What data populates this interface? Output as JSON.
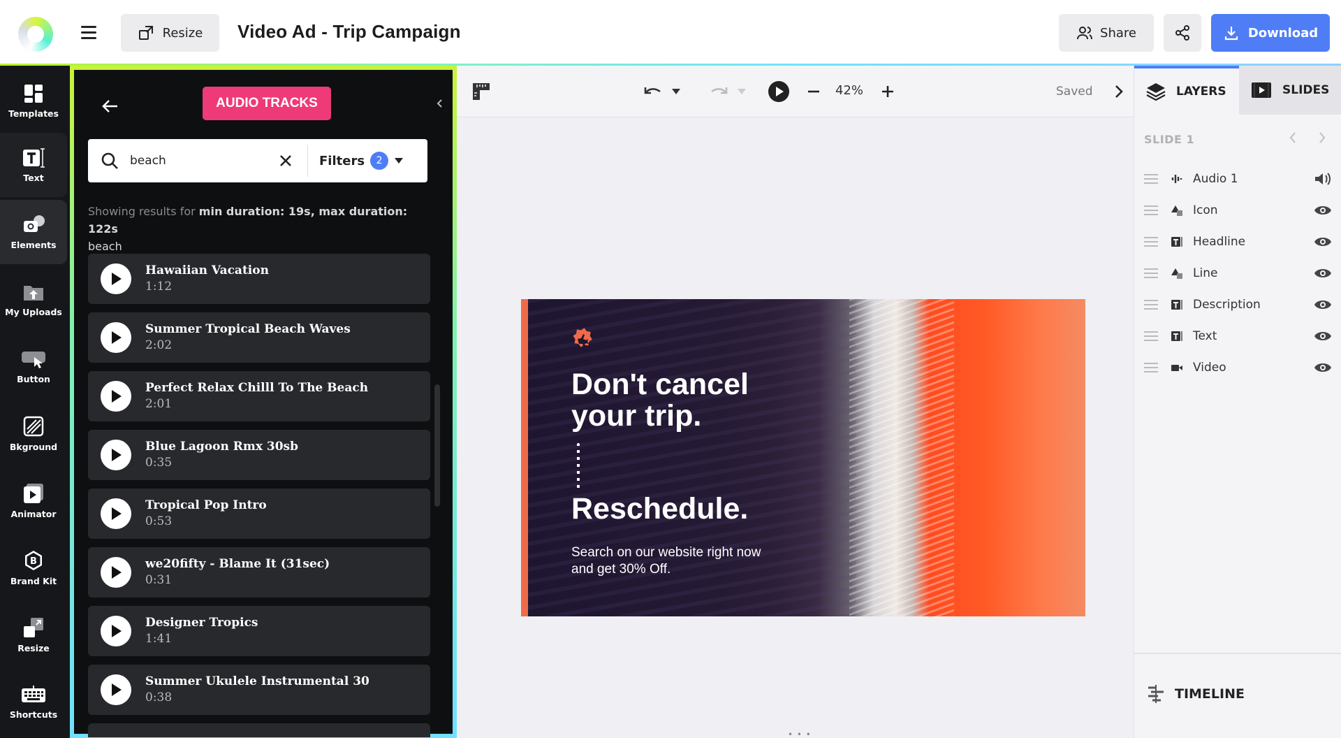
{
  "header": {
    "resize_label": "Resize",
    "title": "Video Ad - Trip Campaign",
    "share_label": "Share",
    "download_label": "Download",
    "accent_color": "#4f7df5"
  },
  "rail": {
    "items": [
      {
        "label": "Templates",
        "icon": "templates-icon"
      },
      {
        "label": "Text",
        "icon": "text-icon"
      },
      {
        "label": "Elements",
        "icon": "elements-icon"
      },
      {
        "label": "My Uploads",
        "icon": "uploads-icon"
      },
      {
        "label": "Button",
        "icon": "button-icon"
      },
      {
        "label": "Bkground",
        "icon": "background-icon"
      },
      {
        "label": "Animator",
        "icon": "animator-icon"
      },
      {
        "label": "Brand Kit",
        "icon": "brand-kit-icon"
      },
      {
        "label": "Resize",
        "icon": "resize-icon"
      },
      {
        "label": "Shortcuts",
        "icon": "keyboard-icon"
      }
    ]
  },
  "audio_panel": {
    "title": "AUDIO TRACKS",
    "title_color": "#ee3a76",
    "search": {
      "value": "beach",
      "placeholder": ""
    },
    "filters_label": "Filters",
    "filters_count": "2",
    "results_prefix": "Showing results for",
    "results_filters": "min duration: 19s, max duration: 122s",
    "results_query": "beach",
    "tracks": [
      {
        "name": "Hawaiian Vacation",
        "duration": "1:12"
      },
      {
        "name": "Summer Tropical Beach Waves",
        "duration": "2:02"
      },
      {
        "name": "Perfect Relax Chilll To The Beach",
        "duration": "2:01"
      },
      {
        "name": "Blue Lagoon Rmx 30sb",
        "duration": "0:35"
      },
      {
        "name": "Tropical Pop Intro",
        "duration": "0:53"
      },
      {
        "name": "we20fifty - Blame It (31sec)",
        "duration": "0:31"
      },
      {
        "name": "Designer Tropics",
        "duration": "1:41"
      },
      {
        "name": "Summer Ukulele Instrumental 30",
        "duration": "0:38"
      }
    ]
  },
  "toolbar": {
    "zoom": "42%",
    "status": "Saved"
  },
  "slide": {
    "headline": "Don't cancel your trip.",
    "subhead": "Reschedule.",
    "description": "Search on our website right now and get 30% Off.",
    "accent_color": "#f06a4a"
  },
  "right_panel": {
    "layers_tab": "LAYERS",
    "slides_tab": "SLIDES",
    "slide_label": "SLIDE 1",
    "layers": [
      {
        "name": "Audio 1",
        "type": "audio-icon",
        "visibility": "speaker-icon"
      },
      {
        "name": "Icon",
        "type": "shape-icon",
        "visibility": "eye-icon"
      },
      {
        "name": "Headline",
        "type": "text-layer-icon",
        "visibility": "eye-icon"
      },
      {
        "name": "Line",
        "type": "shape-icon",
        "visibility": "eye-icon"
      },
      {
        "name": "Description",
        "type": "text-layer-icon",
        "visibility": "eye-icon"
      },
      {
        "name": "Text",
        "type": "text-layer-icon",
        "visibility": "eye-icon"
      },
      {
        "name": "Video",
        "type": "video-icon",
        "visibility": "eye-icon"
      }
    ],
    "timeline_label": "TIMELINE"
  }
}
